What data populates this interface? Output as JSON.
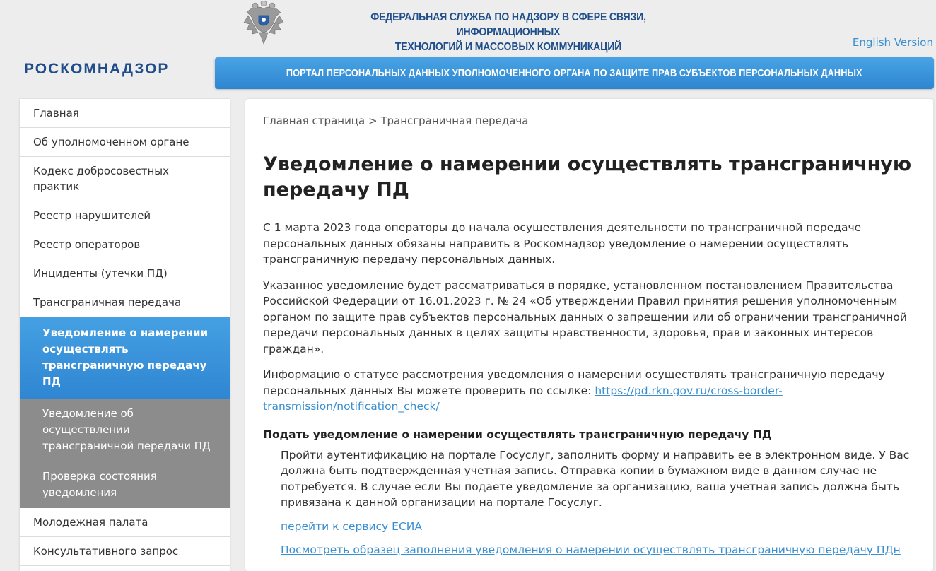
{
  "header": {
    "agency_title_line1": "ФЕДЕРАЛЬНАЯ СЛУЖБА ПО НАДЗОРУ В СФЕРЕ СВЯЗИ, ИНФОРМАЦИОННЫХ",
    "agency_title_line2": "ТЕХНОЛОГИЙ И МАССОВЫХ КОММУНИКАЦИЙ",
    "english_link": "English Version",
    "logo_text": "РОСКОМНАДЗОР",
    "portal_banner": "ПОРТАЛ ПЕРСОНАЛЬНЫХ ДАННЫХ УПОЛНОМОЧЕННОГО ОРГАНА ПО ЗАЩИТЕ ПРАВ СУБЪЕКТОВ ПЕРСОНАЛЬНЫХ ДАННЫХ"
  },
  "sidebar": {
    "items": [
      {
        "label": "Главная"
      },
      {
        "label": "Об уполномоченном органе"
      },
      {
        "label": "Кодекс добросовестных практик"
      },
      {
        "label": "Реестр нарушителей"
      },
      {
        "label": "Реестр операторов"
      },
      {
        "label": "Инциденты (утечки ПД)"
      },
      {
        "label": "Трансграничная передача"
      }
    ],
    "subitems": [
      {
        "label": "Уведомление о намерении осуществлять трансграничную передачу ПД"
      },
      {
        "label": "Уведомление об осуществлении трансграничной передачи ПД"
      },
      {
        "label": "Проверка состояния уведомления"
      }
    ],
    "after_items": [
      {
        "label": "Молодежная палата"
      },
      {
        "label": "Консультативного запрос"
      }
    ]
  },
  "main": {
    "breadcrumb_home": "Главная страница",
    "breadcrumb_sep": " > ",
    "breadcrumb_current": "Трансграничная передача",
    "title": "Уведомление о намерении осуществлять трансграничную передачу ПД",
    "para1": "С 1 марта 2023 года операторы до начала осуществления деятельности по трансграничной передаче персональных данных обязаны направить в Роскомнадзор уведомление о намерении осуществлять трансграничную передачу персональных данных.",
    "para2": "Указанное уведомление будет рассматриваться в порядке, установленном постановлением Правительства Российской Федерации от 16.01.2023 г. № 24 «Об утверждении Правил принятия решения уполномоченным органом по защите прав субъектов персональных данных о запрещении или об ограничении трансграничной передачи персональных данных в целях защиты нравственности, здоровья, прав и законных интересов граждан».",
    "para3_text": "Информацию о статусе рассмотрения уведомления о намерении осуществлять трансграничную передачу персональных данных Вы можете проверить по ссылке: ",
    "para3_link": "https://pd.rkn.gov.ru/cross-border-transmission/notification_check/",
    "subheading": "Подать уведомление о намерении осуществлять трансграничную передачу ПД",
    "para4": "Пройти аутентификацию на портале Госуслуг, заполнить форму и направить ее в электронном виде. У Вас должна быть подтвержденная учетная запись. Отправка копии в бумажном виде в данном случае не потребуется. В случае если Вы подаете уведомление за организацию, ваша учетная запись должна быть привязана к данной организации на портале Госуслуг.",
    "link_esia": "перейти к сервису ЕСИА",
    "link_sample": "Посмотреть образец заполнения уведомления о намерении осуществлять трансграничную передачу ПДн"
  },
  "icons": {
    "emblem": "eagle-emblem-icon"
  },
  "colors": {
    "accent_blue": "#2d86d0",
    "title_blue": "#1f4e8a",
    "link": "#3a8fd0",
    "submenu_gray": "#8c8c8c"
  }
}
